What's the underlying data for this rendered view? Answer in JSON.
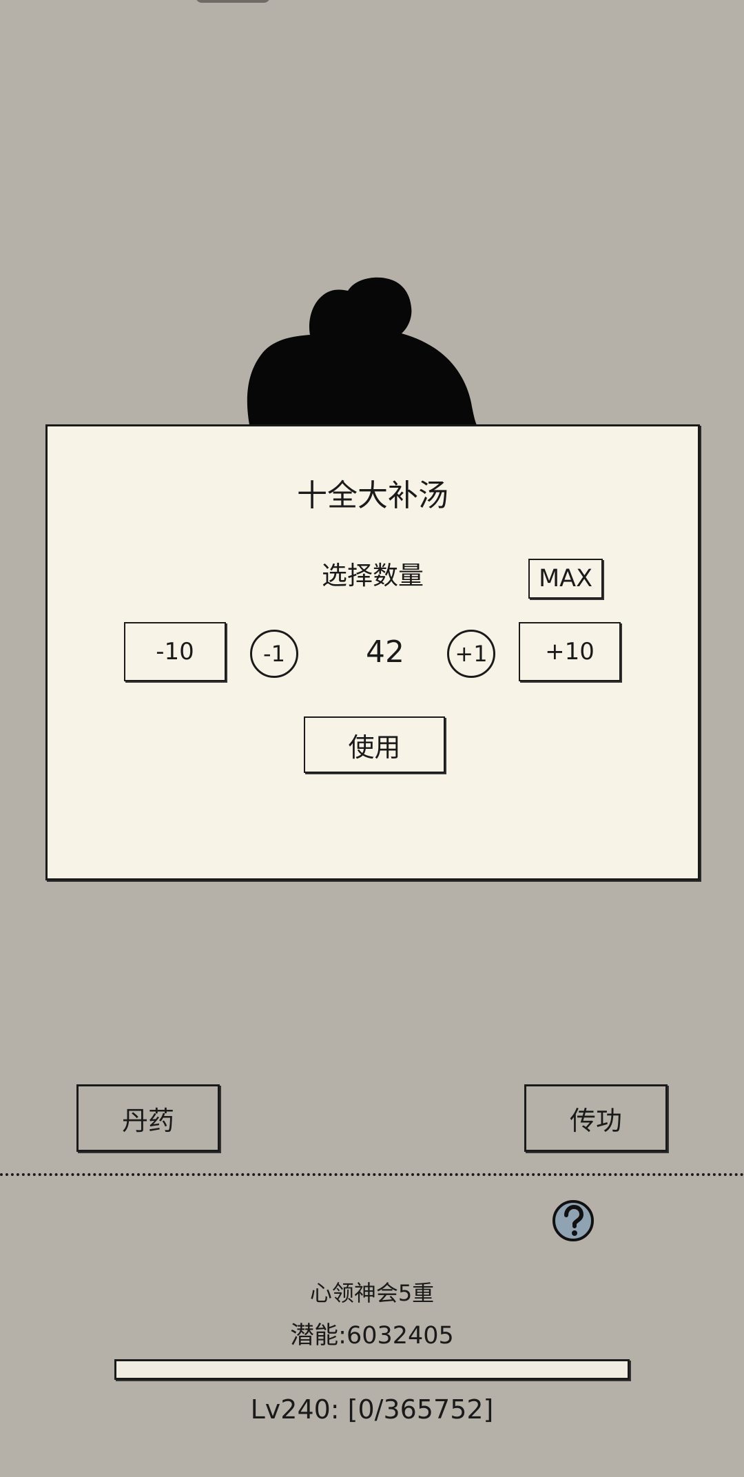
{
  "dialog": {
    "title": "十全大补汤",
    "select_label": "选择数量",
    "max_label": "MAX",
    "minus10_label": "-10",
    "minus1_label": "-1",
    "quantity": "42",
    "plus1_label": "+1",
    "plus10_label": "+10",
    "use_label": "使用"
  },
  "actions": {
    "pill_label": "丹药",
    "transfer_label": "传功"
  },
  "stats": {
    "realm": "心领神会5重",
    "potential": "潜能:6032405",
    "exp_progress": 0,
    "level": "Lv240: [0/365752]"
  },
  "colors": {
    "background": "#b6b1a8",
    "dialog": "#f7f3e6",
    "ink": "#1a1a1a",
    "help_icon": "#8fa3b3"
  },
  "icons": {
    "help": "question-circle-icon"
  }
}
